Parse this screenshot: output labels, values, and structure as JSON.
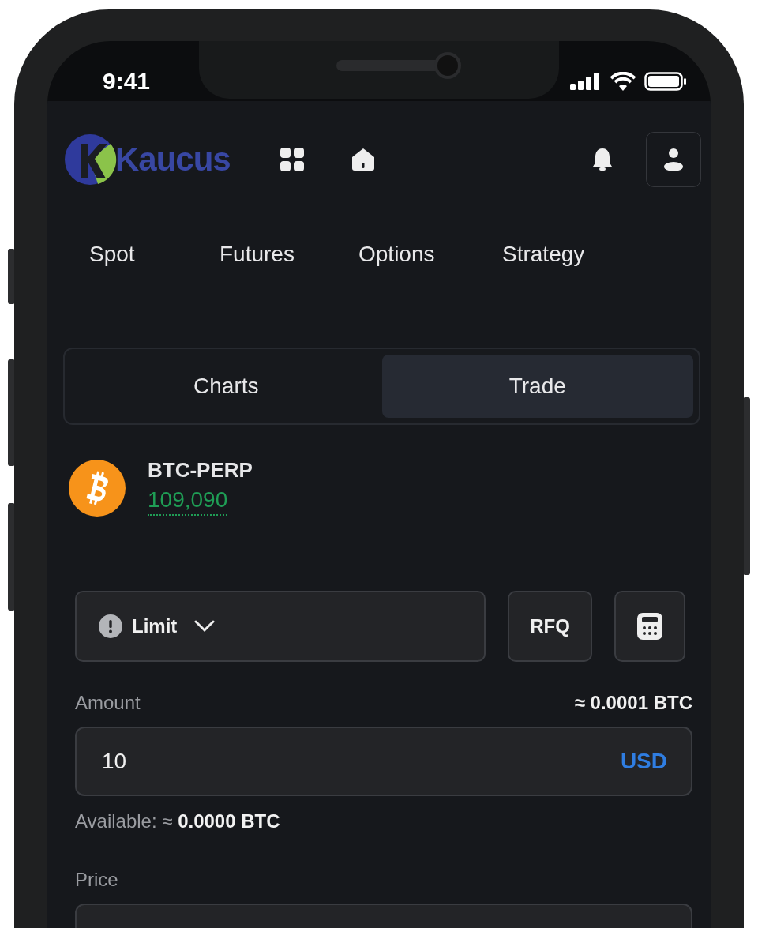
{
  "status_bar": {
    "time": "9:41"
  },
  "header": {
    "logo_text": "Kaucus"
  },
  "nav": [
    {
      "label": "Spot"
    },
    {
      "label": "Futures"
    },
    {
      "label": "Options"
    },
    {
      "label": "Strategy"
    }
  ],
  "view_tabs": [
    {
      "label": "Charts",
      "selected": false
    },
    {
      "label": "Trade",
      "selected": true
    }
  ],
  "instrument": {
    "symbol": "BTC-PERP",
    "price": "109,090"
  },
  "order_type": {
    "value": "Limit"
  },
  "rfq_button": "RFQ",
  "amount": {
    "label": "Amount",
    "conversion": "≈ 0.0001 BTC",
    "value": "10",
    "unit": "USD",
    "available": "Available: ≈ **0.0000 BTC**"
  },
  "price": {
    "label": "Price"
  }
}
